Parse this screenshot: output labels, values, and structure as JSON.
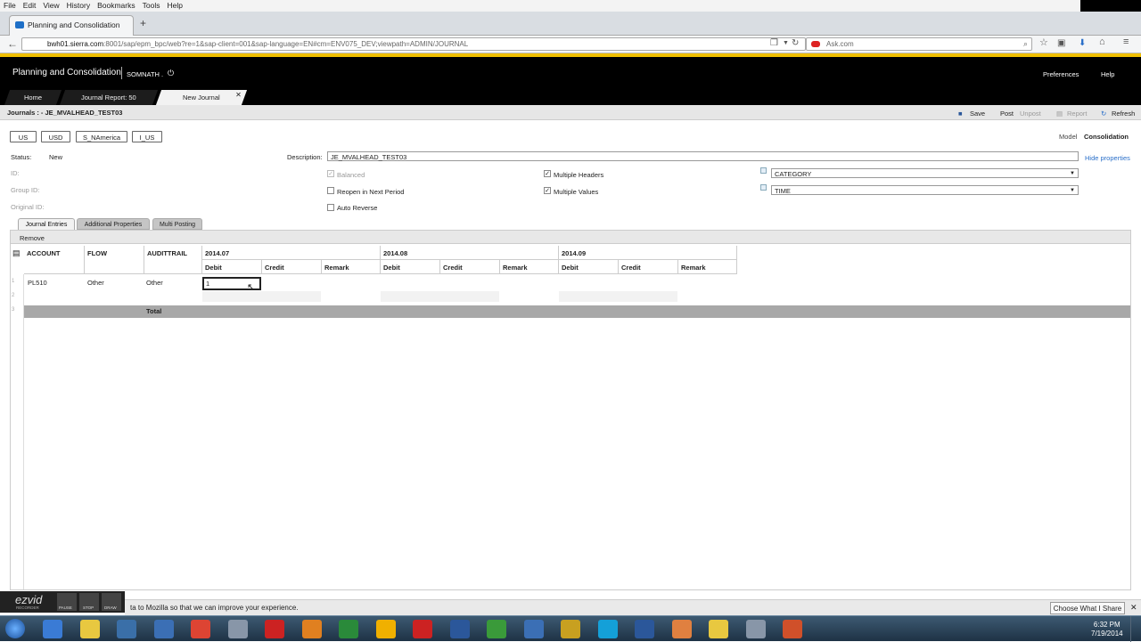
{
  "browser": {
    "menu": [
      "File",
      "Edit",
      "View",
      "History",
      "Bookmarks",
      "Tools",
      "Help"
    ],
    "tab_title": "Planning and Consolidation",
    "url_host": "bwh01.sierra.com",
    "url_rest": ":8001/sap/epm_bpc/web?re=1&sap-client=001&sap-language=EN#cm=ENV075_DEV;viewpath=ADMIN/JOURNAL",
    "search_placeholder": "Ask.com"
  },
  "app": {
    "title": "Planning and Consolidation",
    "user": "SOMNATH .",
    "preferences": "Preferences",
    "help": "Help",
    "tabs": [
      "Home",
      "Journal Report: 50",
      "New Journal"
    ]
  },
  "toolbar": {
    "journal_title": "Journals : - JE_MVALHEAD_TEST03",
    "save": "Save",
    "post": "Post",
    "unpost": "Unpost",
    "report": "Report",
    "refresh": "Refresh"
  },
  "chips": [
    "US",
    "USD",
    "S_NAmerica",
    "I_US"
  ],
  "model_label": "Model",
  "model_value": "Consolidation",
  "hide_properties": "Hide properties",
  "form": {
    "status_label": "Status:",
    "status_value": "New",
    "id_label": "ID:",
    "group_id_label": "Group ID:",
    "original_id_label": "Original ID:",
    "description_label": "Description:",
    "description_value": "JE_MVALHEAD_TEST03",
    "balanced": "Balanced",
    "reopen": "Reopen in Next Period",
    "auto_reverse": "Auto Reverse",
    "multiple_headers": "Multiple Headers",
    "multiple_values": "Multiple Values",
    "category": "CATEGORY",
    "time": "TIME"
  },
  "section_tabs": [
    "Journal Entries",
    "Additional Properties",
    "Multi Posting"
  ],
  "grid": {
    "remove": "Remove",
    "headers": [
      "ACCOUNT",
      "FLOW",
      "AUDITTRAIL"
    ],
    "periods": [
      "2014.07",
      "2014.08",
      "2014.09"
    ],
    "subheaders": [
      "Debit",
      "Credit",
      "Remark"
    ],
    "row_numbers": [
      "1",
      "2",
      "3"
    ],
    "row1": [
      "PL510",
      "Other",
      "Other"
    ],
    "edit_value": "1",
    "total": "Total"
  },
  "ezvid": {
    "brand": "ezvid",
    "sub": "RECORDER",
    "pause": "PAUSE",
    "stop": "STOP",
    "draw": "DRAW"
  },
  "notification": {
    "message": "ta to Mozilla so that we can improve your experience.",
    "share": "Choose What I Share"
  },
  "clock": {
    "time": "6:32 PM",
    "date": "7/19/2014"
  },
  "taskbar_colors": [
    "#3a7bd5",
    "#e8c840",
    "#3a6fa8",
    "#3b6fb5",
    "#dd4433",
    "#8896a8",
    "#c22",
    "#e08020",
    "#2a8a3a",
    "#f0b000",
    "#c22",
    "#2b579a",
    "#3a9a3a",
    "#3b6fb5",
    "#c8a020",
    "#14a0d8",
    "#2b579a",
    "#e08040",
    "#e8c840",
    "#8896a8",
    "#d0502a"
  ]
}
